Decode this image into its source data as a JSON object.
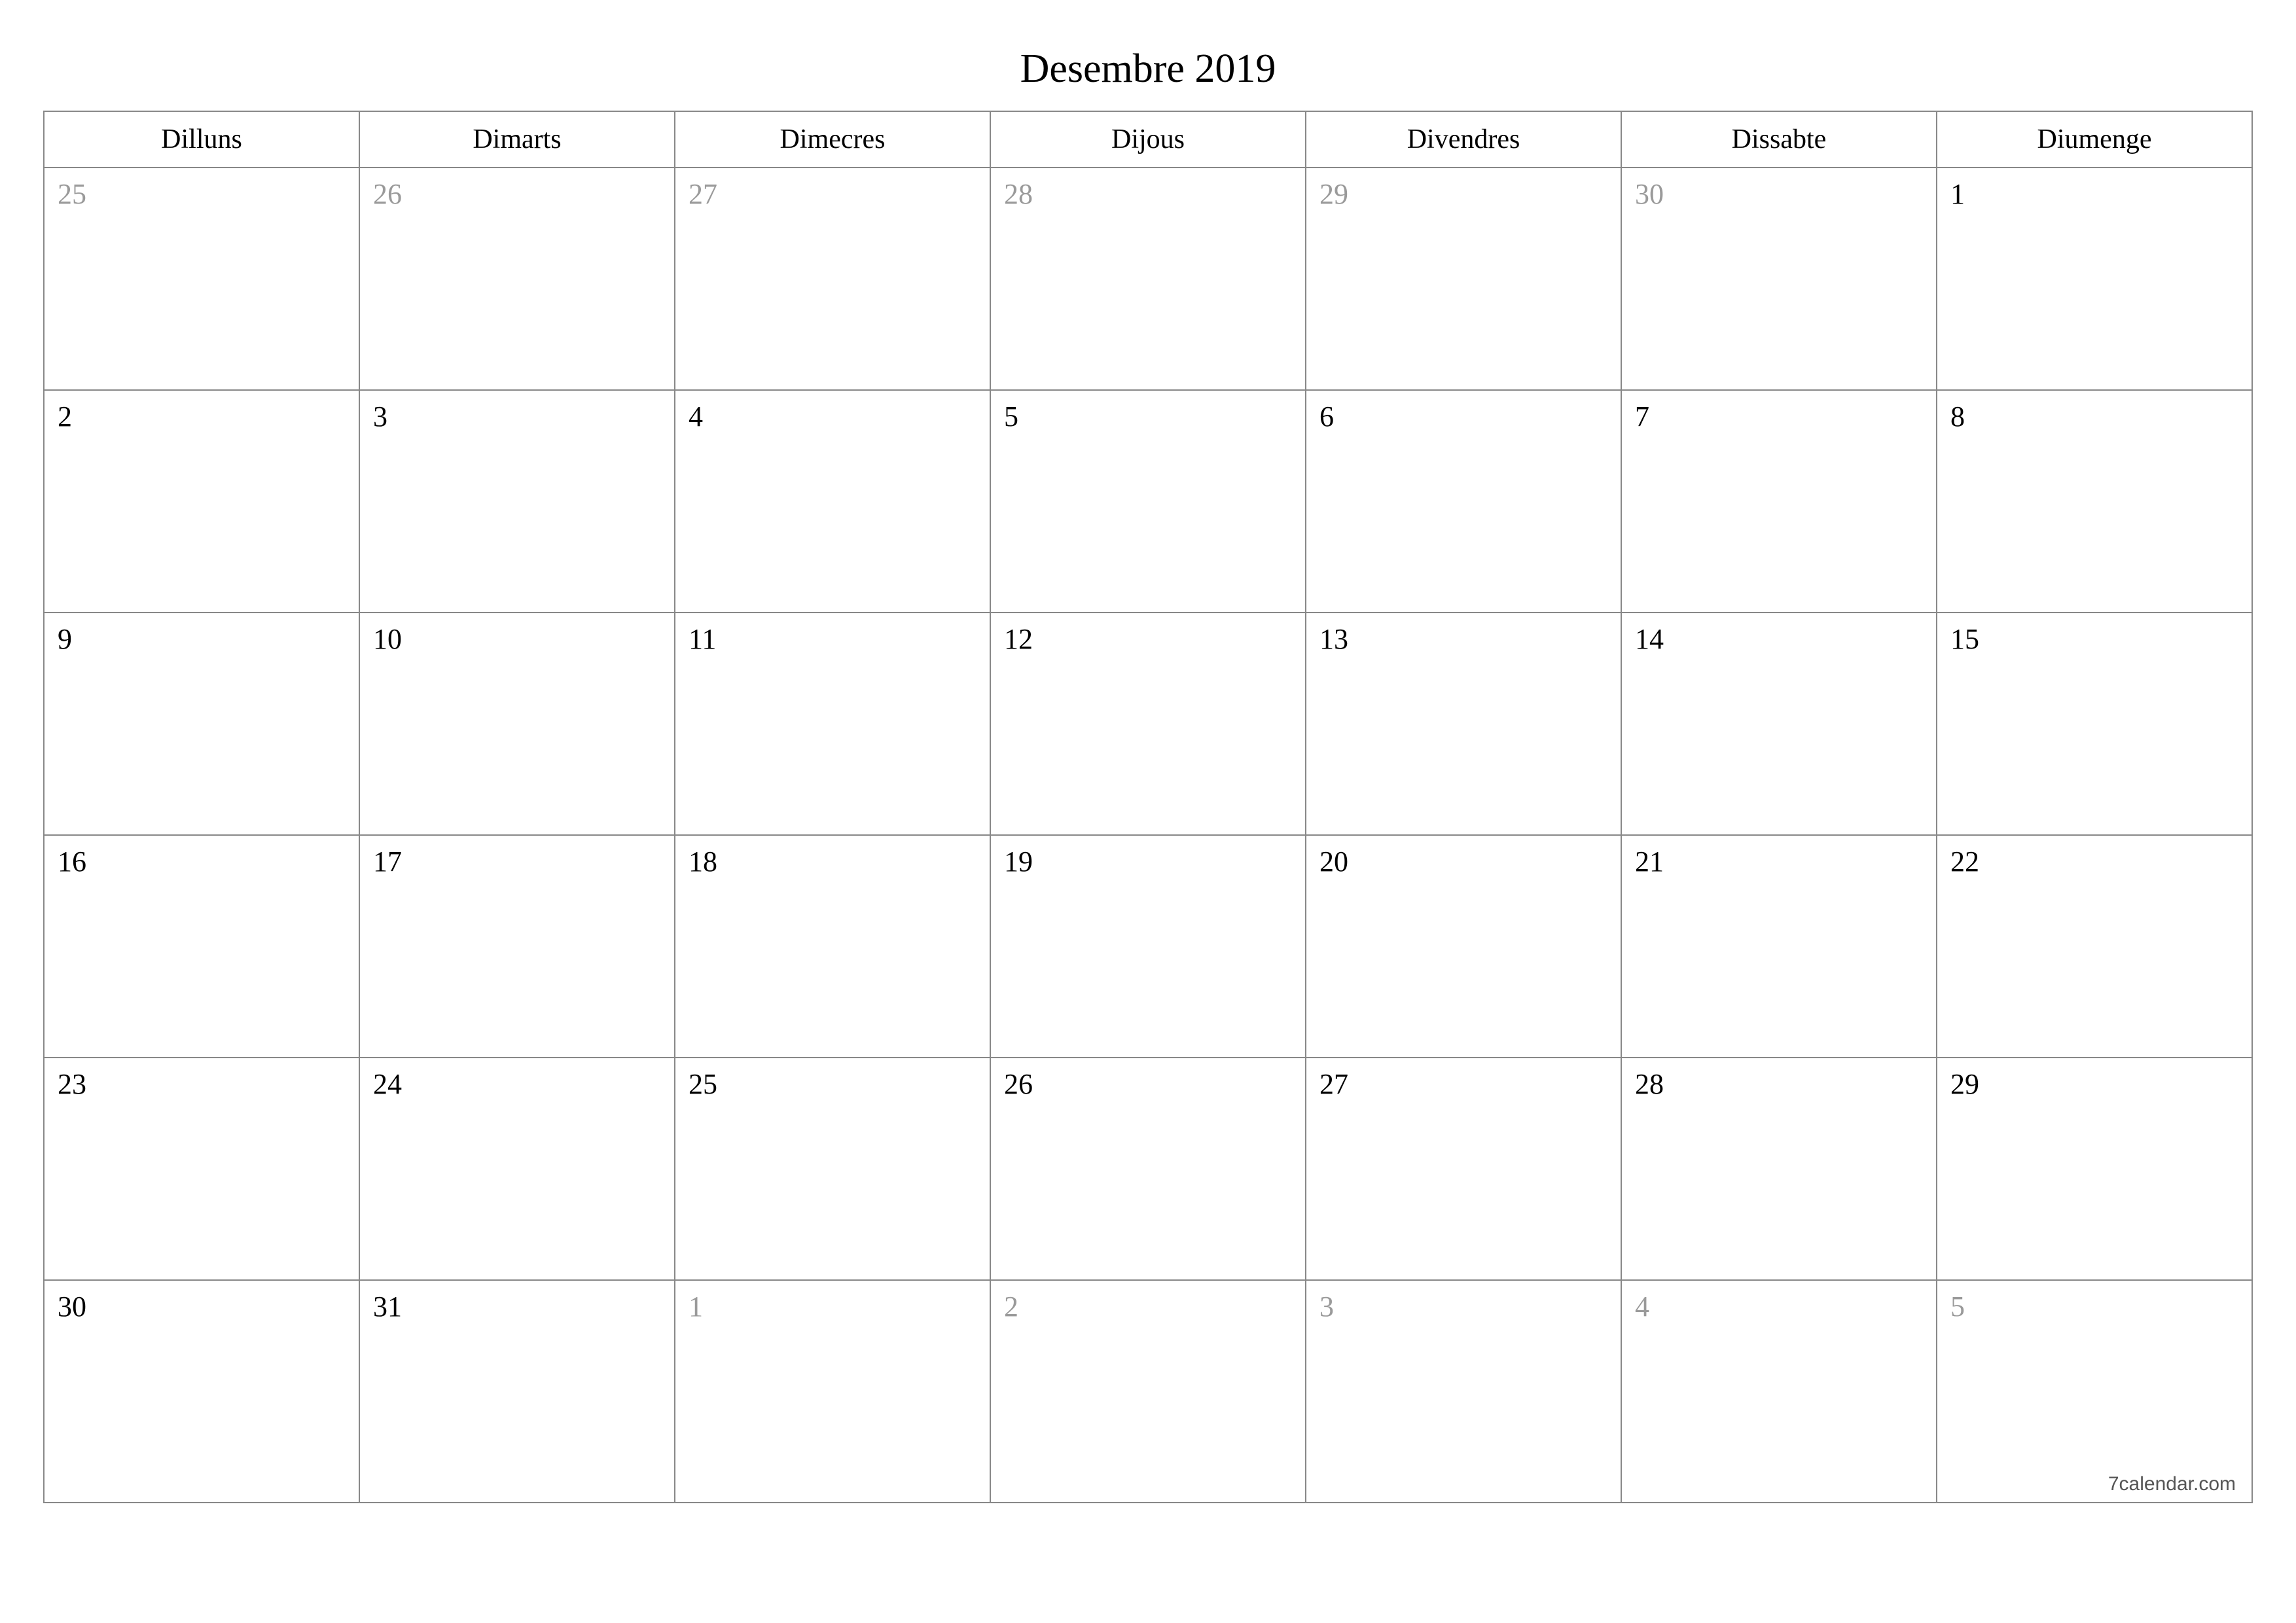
{
  "title": "Desembre 2019",
  "weekdays": [
    "Dilluns",
    "Dimarts",
    "Dimecres",
    "Dijous",
    "Divendres",
    "Dissabte",
    "Diumenge"
  ],
  "weeks": [
    [
      {
        "n": "25",
        "out": true
      },
      {
        "n": "26",
        "out": true
      },
      {
        "n": "27",
        "out": true
      },
      {
        "n": "28",
        "out": true
      },
      {
        "n": "29",
        "out": true
      },
      {
        "n": "30",
        "out": true
      },
      {
        "n": "1",
        "out": false
      }
    ],
    [
      {
        "n": "2",
        "out": false
      },
      {
        "n": "3",
        "out": false
      },
      {
        "n": "4",
        "out": false
      },
      {
        "n": "5",
        "out": false
      },
      {
        "n": "6",
        "out": false
      },
      {
        "n": "7",
        "out": false
      },
      {
        "n": "8",
        "out": false
      }
    ],
    [
      {
        "n": "9",
        "out": false
      },
      {
        "n": "10",
        "out": false
      },
      {
        "n": "11",
        "out": false
      },
      {
        "n": "12",
        "out": false
      },
      {
        "n": "13",
        "out": false
      },
      {
        "n": "14",
        "out": false
      },
      {
        "n": "15",
        "out": false
      }
    ],
    [
      {
        "n": "16",
        "out": false
      },
      {
        "n": "17",
        "out": false
      },
      {
        "n": "18",
        "out": false
      },
      {
        "n": "19",
        "out": false
      },
      {
        "n": "20",
        "out": false
      },
      {
        "n": "21",
        "out": false
      },
      {
        "n": "22",
        "out": false
      }
    ],
    [
      {
        "n": "23",
        "out": false
      },
      {
        "n": "24",
        "out": false
      },
      {
        "n": "25",
        "out": false
      },
      {
        "n": "26",
        "out": false
      },
      {
        "n": "27",
        "out": false
      },
      {
        "n": "28",
        "out": false
      },
      {
        "n": "29",
        "out": false
      }
    ],
    [
      {
        "n": "30",
        "out": false
      },
      {
        "n": "31",
        "out": false
      },
      {
        "n": "1",
        "out": true
      },
      {
        "n": "2",
        "out": true
      },
      {
        "n": "3",
        "out": true
      },
      {
        "n": "4",
        "out": true
      },
      {
        "n": "5",
        "out": true
      }
    ]
  ],
  "footer": "7calendar.com"
}
